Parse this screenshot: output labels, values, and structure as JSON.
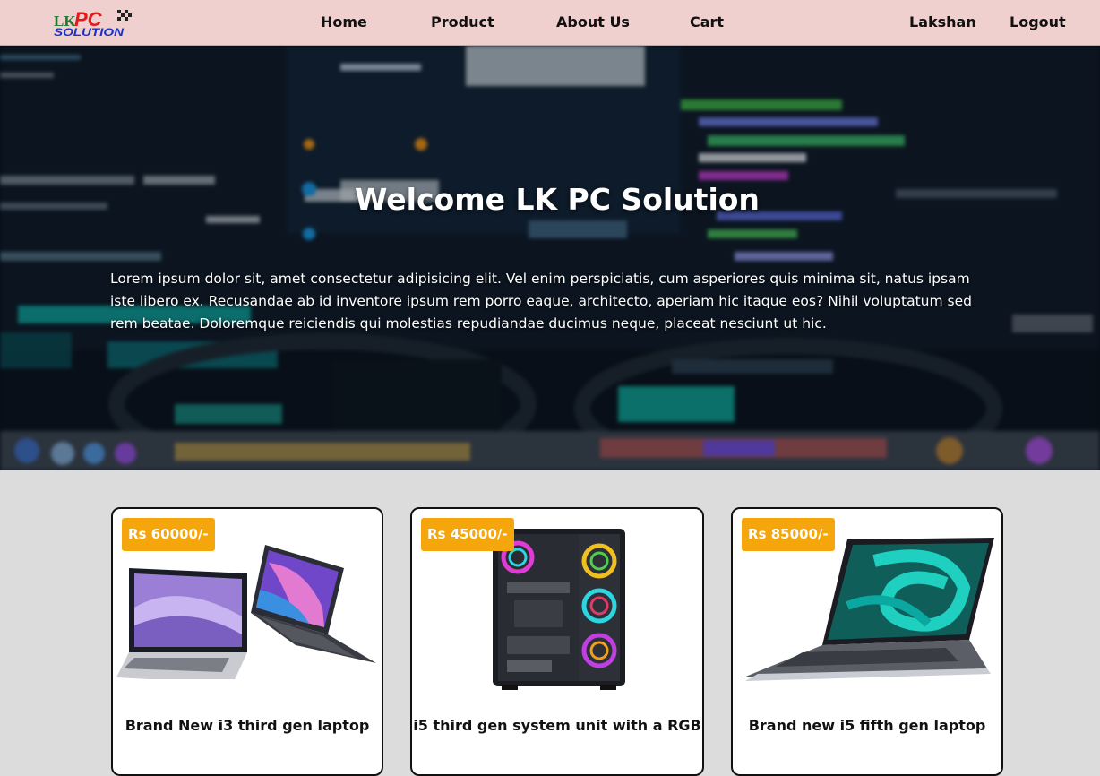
{
  "brand": {
    "logo_top": "LK",
    "logo_pc": "PC",
    "logo_bottom": "SOLUTION"
  },
  "nav": {
    "home": "Home",
    "product": "Product",
    "about": "About Us",
    "cart": "Cart",
    "user": "Lakshan",
    "logout": "Logout"
  },
  "hero": {
    "title": "Welcome LK PC Solution",
    "text": "Lorem ipsum dolor sit, amet consectetur adipisicing elit. Vel enim perspiciatis, cum asperiores quis minima sit, natus ipsam iste libero ex. Recusandae ab id inventore ipsum rem porro eaque, architecto, aperiam hic itaque eos? Nihil voluptatum sed rem beatae. Doloremque reiciendis qui molestias repudiandae ducimus neque, placeat nesciunt ut hic."
  },
  "products": [
    {
      "price": "Rs 60000/-",
      "title": "Brand New i3 third gen laptop"
    },
    {
      "price": "Rs 45000/-",
      "title": "i5 third gen system unit with a RGB"
    },
    {
      "price": "Rs 85000/-",
      "title": "Brand new i5 fifth gen laptop"
    }
  ],
  "colors": {
    "nav_bg": "#f0cfcf",
    "price_badge": "#f5a60c",
    "page_bg": "#dcdcdc"
  }
}
